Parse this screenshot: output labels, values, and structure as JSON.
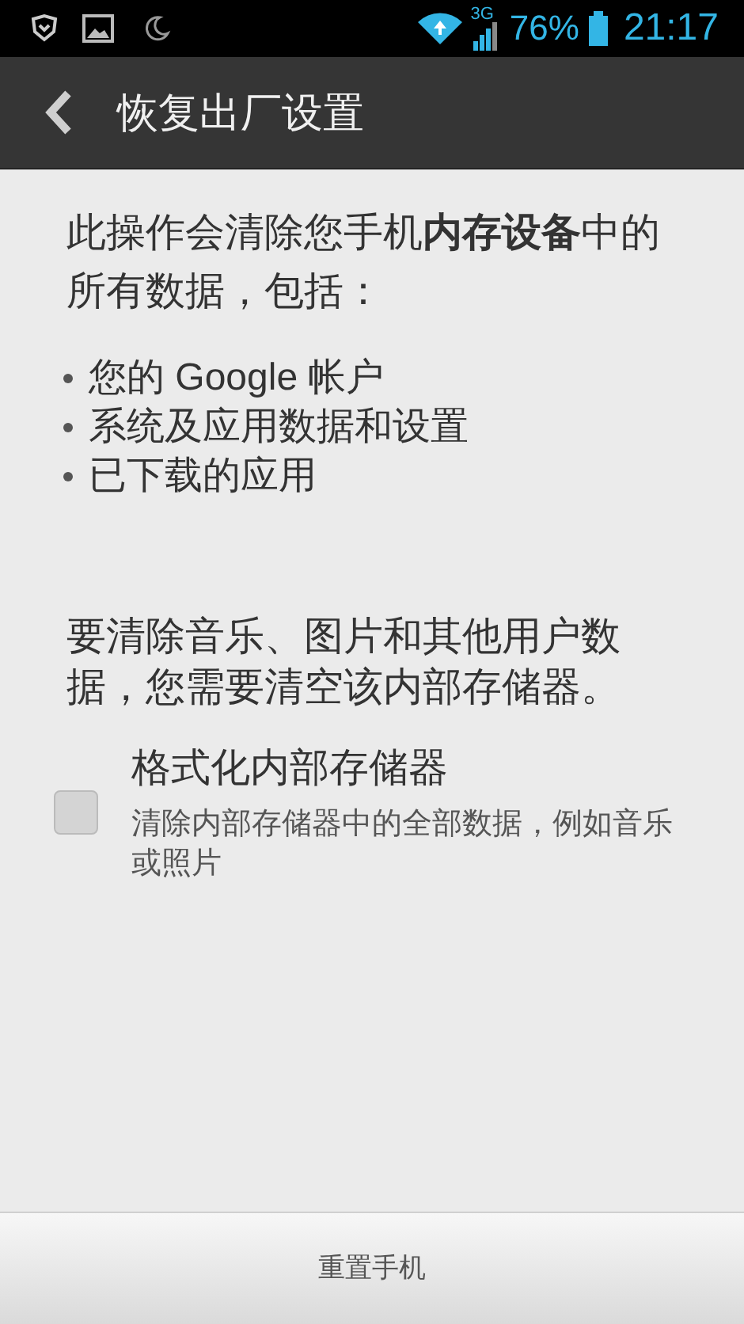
{
  "status_bar": {
    "network": "3G",
    "battery": "76%",
    "time": "21:17"
  },
  "header": {
    "title": "恢复出厂设置"
  },
  "intro": "此操作会清除您手机**内存设备**中的所有数据，包括：",
  "items": [
    "您的 Google 帐户",
    "系统及应用数据和设置",
    "已下载的应用"
  ],
  "note": "要清除音乐、图片和其他用户数据，您需要清空该内部存储器。",
  "option": {
    "title": "格式化内部存储器",
    "description": "清除内部存储器中的全部数据，例如音乐或照片",
    "checked": false
  },
  "button": "重置手机"
}
